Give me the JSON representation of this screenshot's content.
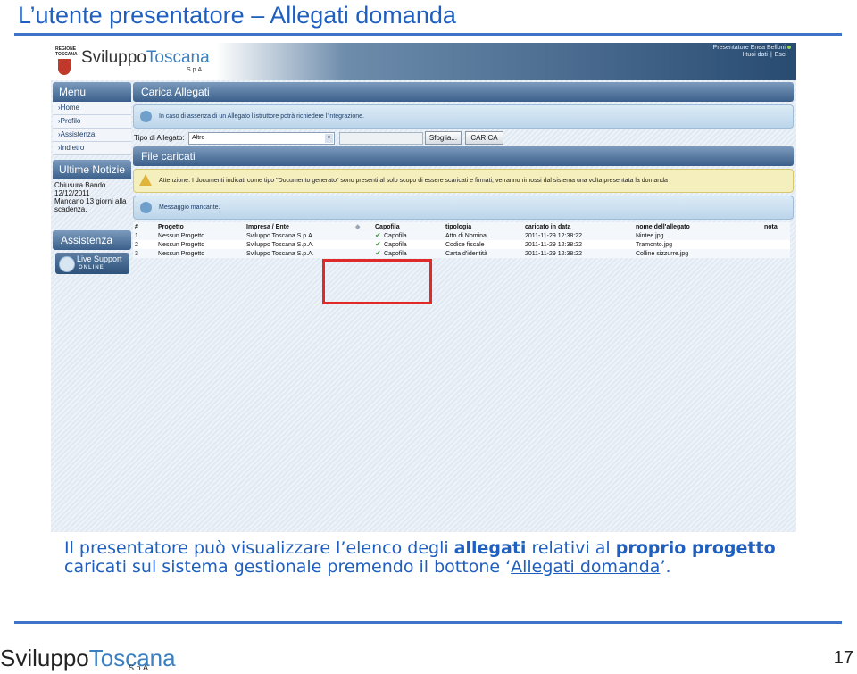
{
  "slide": {
    "title": "L’utente presentatore – Allegati domanda",
    "page_number": "17",
    "caption": {
      "p1": "Il presentatore può visualizzare l’elenco degli ",
      "b1": "allegati",
      "p2": " relativi al ",
      "b2": "proprio progetto",
      "p3": " caricati sul sistema gestionale premendo il bottone ‘",
      "u1": "Allegati domanda",
      "p4": "’."
    },
    "footer_logo": {
      "a": "Sviluppo",
      "b": "Toscana",
      "spa": "S.p.A."
    }
  },
  "app": {
    "logo": {
      "a": "Sviluppo",
      "b": "Toscana",
      "spa": "S.p.A.",
      "region_line1": "REGIONE",
      "region_line2": "TOSCANA"
    },
    "header": {
      "user": "Presentatore Enea Belloni",
      "links": [
        "I tuoi dati",
        "Esci"
      ]
    },
    "sidebar": {
      "menu_title": "Menu",
      "items": [
        "›Home",
        "›Profilo",
        "›Assistenza",
        "›Indietro"
      ],
      "news_title": "Ultime Notizie",
      "news": [
        "Chiusura Bando",
        "12/12/2011",
        "Mancano 13 giorni alla",
        "scadenza."
      ],
      "assist_title": "Assistenza",
      "live_label": "Live Support",
      "live_online": "ONLINE"
    },
    "upload_panel": {
      "title": "Carica Allegati",
      "info_text": "In caso di assenza di un Allegato l’istruttore potrà richiedere l’integrazione.",
      "type_label": "Tipo di Allegato:",
      "type_value": "Altro",
      "browse_button": "Sfoglia...",
      "upload_button": "CARICA"
    },
    "files_panel": {
      "title": "File caricati",
      "warning": "Attenzione: I documenti indicati come tipo \"Documento generato\" sono presenti al solo scopo di essere scaricati e firmati, verranno rimossi dal sistema una volta presentata la domanda",
      "missing_message": "Messaggio mancante.",
      "columns": [
        "#",
        "Progetto",
        "Impresa / Ente",
        "",
        "Capofila",
        "tipologia",
        "caricato in data",
        "nome dell'allegato",
        "nota"
      ],
      "rows": [
        {
          "n": "1",
          "progetto": "Nessun Progetto",
          "impresa": "Sviluppo Toscana S.p.A.",
          "capofila": "Capofila",
          "tipologia": "Atto di Nomina",
          "data": "2011-11-29 12:38:22",
          "nome": "Nintee.jpg",
          "nota": ""
        },
        {
          "n": "2",
          "progetto": "Nessun Progetto",
          "impresa": "Sviluppo Toscana S.p.A.",
          "capofila": "Capofila",
          "tipologia": "Codice fiscale",
          "data": "2011-11-29 12:38:22",
          "nome": "Tramonto.jpg",
          "nota": ""
        },
        {
          "n": "3",
          "progetto": "Nessun Progetto",
          "impresa": "Sviluppo Toscana S.p.A.",
          "capofila": "Capofila",
          "tipologia": "Carta d'identità",
          "data": "2011-11-29 12:38:22",
          "nome": "Colline sizzurre.jpg",
          "nota": ""
        }
      ]
    }
  },
  "colors": {
    "title_blue": "#1f5fbf",
    "rule_blue": "#3f73c8",
    "header_dark": "#284b72",
    "highlight_red": "#e02a2a"
  }
}
